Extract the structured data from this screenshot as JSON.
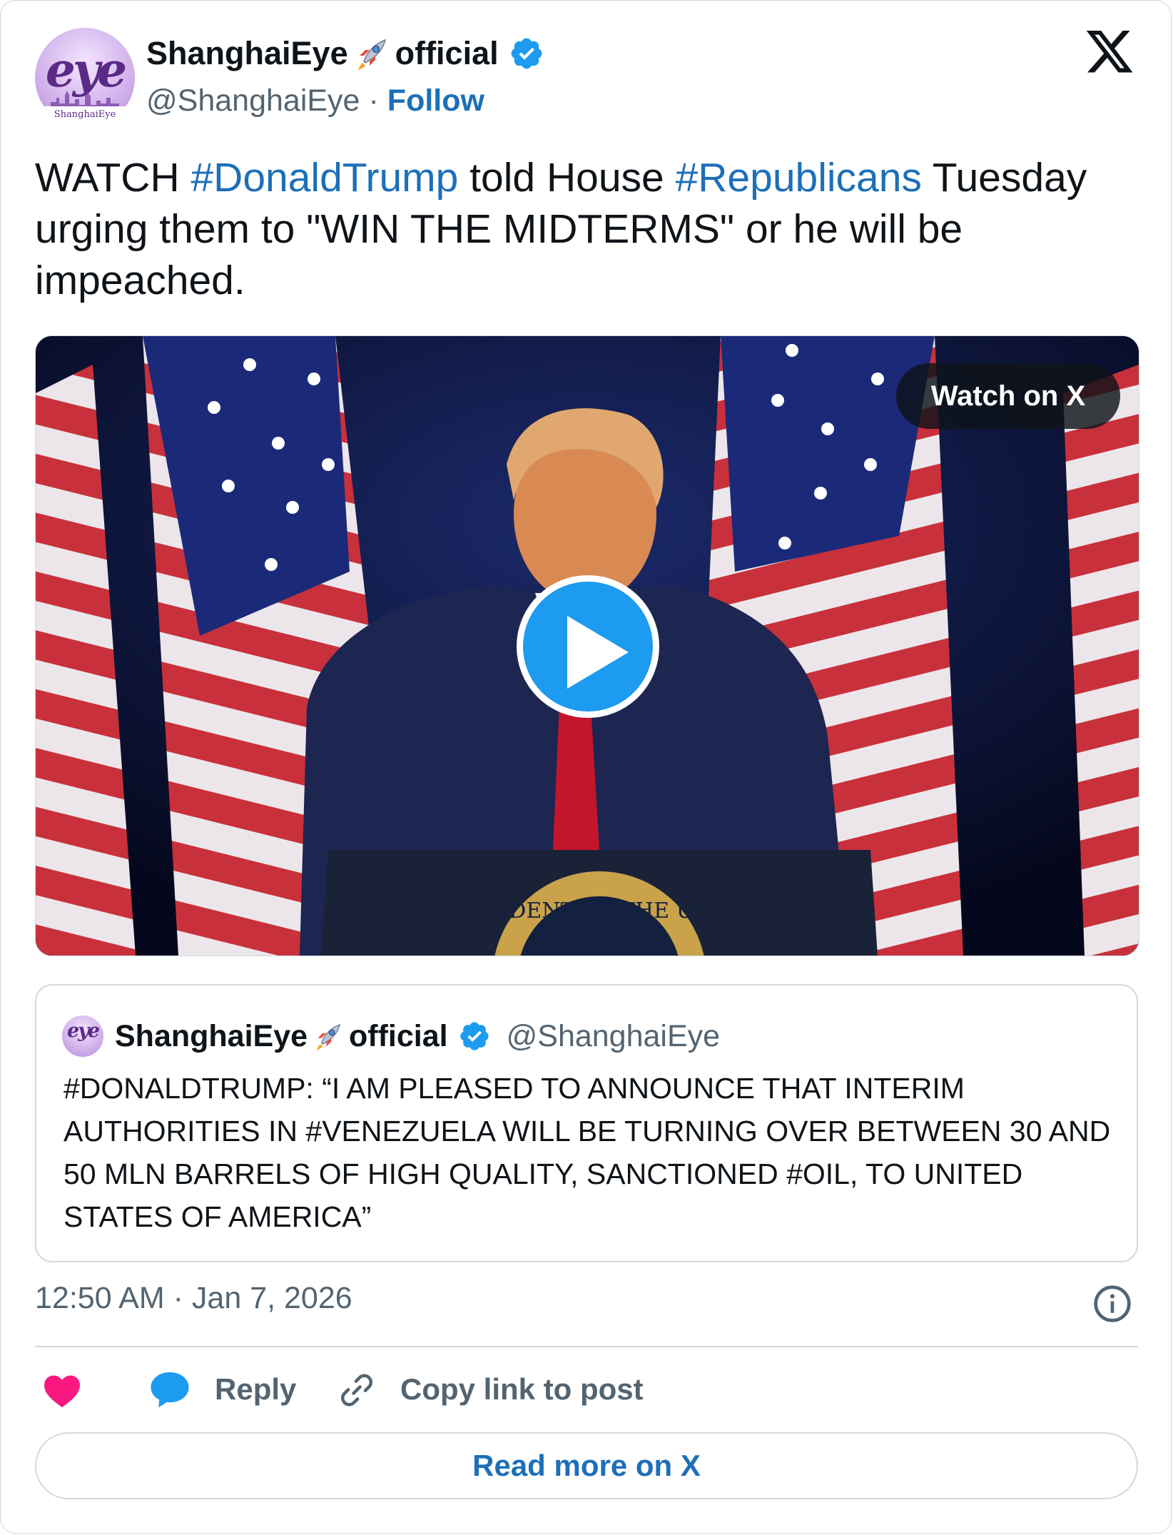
{
  "author": {
    "name_part1": "ShanghaiEye",
    "name_part2": "official",
    "handle": "@ShanghaiEye",
    "separator": "·",
    "follow_label": "Follow",
    "avatar_logo_text": "eye",
    "avatar_ribbon_text": "ShanghaiEye"
  },
  "tweet": {
    "parts": [
      {
        "text": "WATCH ",
        "tag": false
      },
      {
        "text": "#DonaldTrump",
        "tag": true
      },
      {
        "text": " told House ",
        "tag": false
      },
      {
        "text": "#Republicans",
        "tag": true
      },
      {
        "text": " Tuesday urging them to \"WIN THE MIDTERMS\" or he will be impeached.",
        "tag": false
      }
    ]
  },
  "media": {
    "watch_label": "Watch on X",
    "seal_text": "SIDENT OF THE UN"
  },
  "quoted": {
    "name_part1": "ShanghaiEye",
    "name_part2": "official",
    "handle": "@ShanghaiEye",
    "avatar_logo_text": "eye",
    "text": "#DONALDTRUMP: “I AM PLEASED TO ANNOUNCE THAT INTERIM AUTHORITIES IN #VENEZUELA WILL BE TURNING OVER BETWEEN 30 AND 50 MLN BARRELS OF HIGH QUALITY, SANCTIONED #OIL, TO UNITED STATES OF AMERICA”"
  },
  "meta": {
    "time": "12:50 AM",
    "separator": "·",
    "date": "Jan 7, 2026"
  },
  "actions": {
    "reply_label": "Reply",
    "copy_label": "Copy link to post",
    "read_more_label": "Read more on X"
  },
  "colors": {
    "link": "#1d6fb8",
    "play": "#1d9bf0",
    "heart": "#f91880",
    "muted": "#536471"
  },
  "icons": [
    "x-logo-icon",
    "verified-badge-icon",
    "rocket-icon",
    "play-icon",
    "info-icon",
    "heart-icon",
    "reply-bubble-icon",
    "link-icon"
  ]
}
